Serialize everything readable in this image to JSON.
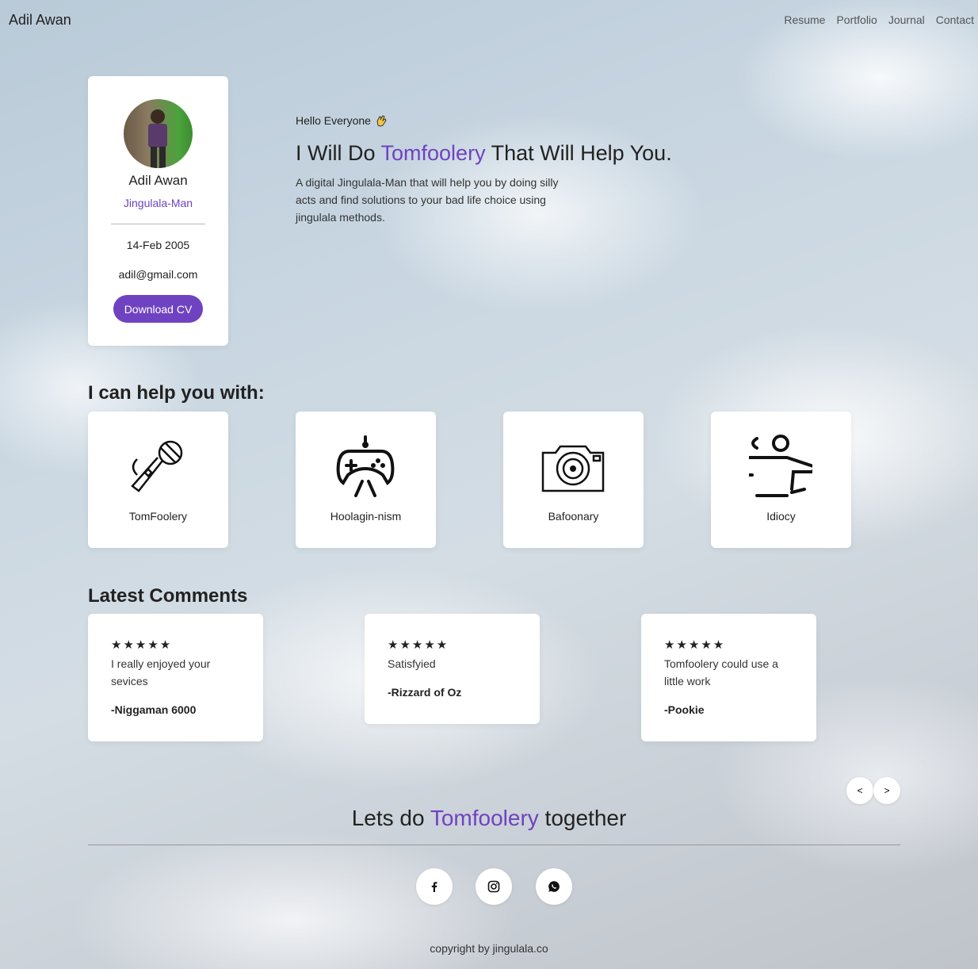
{
  "nav": {
    "brand": "Adil Awan",
    "links": [
      "Resume",
      "Portfolio",
      "Journal",
      "Contact"
    ]
  },
  "profile": {
    "name": "Adil Awan",
    "role": "Jingulala-Man",
    "dob": "14-Feb 2005",
    "email": "adil@gmail.com",
    "cv_button": "Download CV",
    "avatar_icon": "avatar-photo"
  },
  "hero": {
    "greeting": "Hello Everyone",
    "greeting_icon": "waving-hand-icon",
    "headline_pre": "I Will Do ",
    "headline_accent": "Tomfoolery",
    "headline_post": " That Will Help You.",
    "intro": "A digital Jingulala-Man that will help you by doing silly acts and find solutions to your bad life choice using jingulala methods."
  },
  "services": {
    "title": "I can help you with:",
    "items": [
      {
        "label": "TomFoolery",
        "icon": "microphone-icon"
      },
      {
        "label": "Hoolagin-nism",
        "icon": "gamepad-icon"
      },
      {
        "label": "Bafoonary",
        "icon": "camera-icon"
      },
      {
        "label": "Idiocy",
        "icon": "coffee-cup-icon"
      }
    ]
  },
  "comments": {
    "title": "Latest Comments",
    "stars": "★★★★★",
    "items": [
      {
        "text": "I really enjoyed your sevices",
        "author": "-Niggaman 6000",
        "rating": 5
      },
      {
        "text": "Satisfyied",
        "author": "-Rizzard of Oz",
        "rating": 5
      },
      {
        "text": "Tomfoolery could use a little work",
        "author": "-Pookie",
        "rating": 5
      }
    ],
    "prev": "<",
    "next": ">"
  },
  "footer": {
    "cta_pre": "Lets do ",
    "cta_accent": "Tomfoolery",
    "cta_post": " together",
    "social": [
      "facebook-icon",
      "instagram-icon",
      "whatsapp-icon"
    ],
    "copyright": "copyright by jingulala.co"
  },
  "colors": {
    "accent": "#6f42c1",
    "text": "#222222",
    "card": "#ffffff"
  }
}
